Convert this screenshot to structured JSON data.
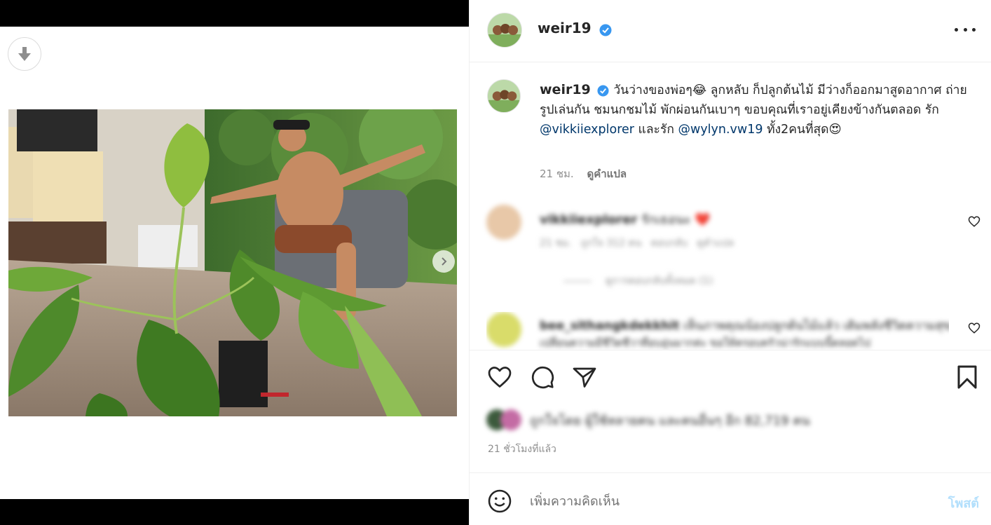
{
  "post": {
    "username": "weir19",
    "verified": true
  },
  "caption": {
    "username": "weir19",
    "text_1": "วันว่างของพ่อๆ😂 ลูกหลับ ก็ปลูกต้นไม้ มีว่างก็ออกมาสูดอากาศ ถ่ายรูปเล่นกัน ชมนกชมไม้ พักผ่อนกันเบาๆ ขอบคุณที่เราอยู่เคียงข้างกันตลอด รัก ",
    "mention_1": "@vikkiiexplorer",
    "text_2": " และรัก ",
    "mention_2": "@wylyn.vw19",
    "text_3": " ทั้ง2คนที่สุด😍",
    "age": "21 ชม.",
    "translate": "ดูคำแปล"
  },
  "comments": [
    {
      "username": "vikkiiexplorer",
      "text": "รักเธอนะ ❤️",
      "meta": "21 ชม.   ถูกใจ 312 คน   ตอบกลับ   ดูคำแปล",
      "replies": "ดูการตอบกลับทั้งหมด (1)"
    },
    {
      "username": "bee_sithangkdekkhit",
      "text": "เห็นภาพคุณน้องปลูกต้นไม้แล้ว เติมพลังชีวิตความสุขมากเลย",
      "meta": "เปลี่ยนความมีชีวิตชีวาที่อบอุ่นมากค่ะ ขอให้ครอบครัวน่ารักแบบนี้ตลอดไป"
    }
  ],
  "actions": {
    "like": "heart-icon",
    "comment": "comment-icon",
    "share": "share-icon",
    "save": "bookmark-icon"
  },
  "likes_text": "ถูกใจโดย ผู้ใช้หลายคน และคนอื่นๆ อีก 82,719 คน",
  "posted_ago": "21 ชั่วโมงที่แล้ว",
  "add_comment": {
    "placeholder": "เพิ่มความคิดเห็น",
    "post_label": "โพสต์"
  },
  "colors": {
    "mention": "#00376b",
    "verified": "#3897f0",
    "post_disabled": "#b2dffc"
  }
}
